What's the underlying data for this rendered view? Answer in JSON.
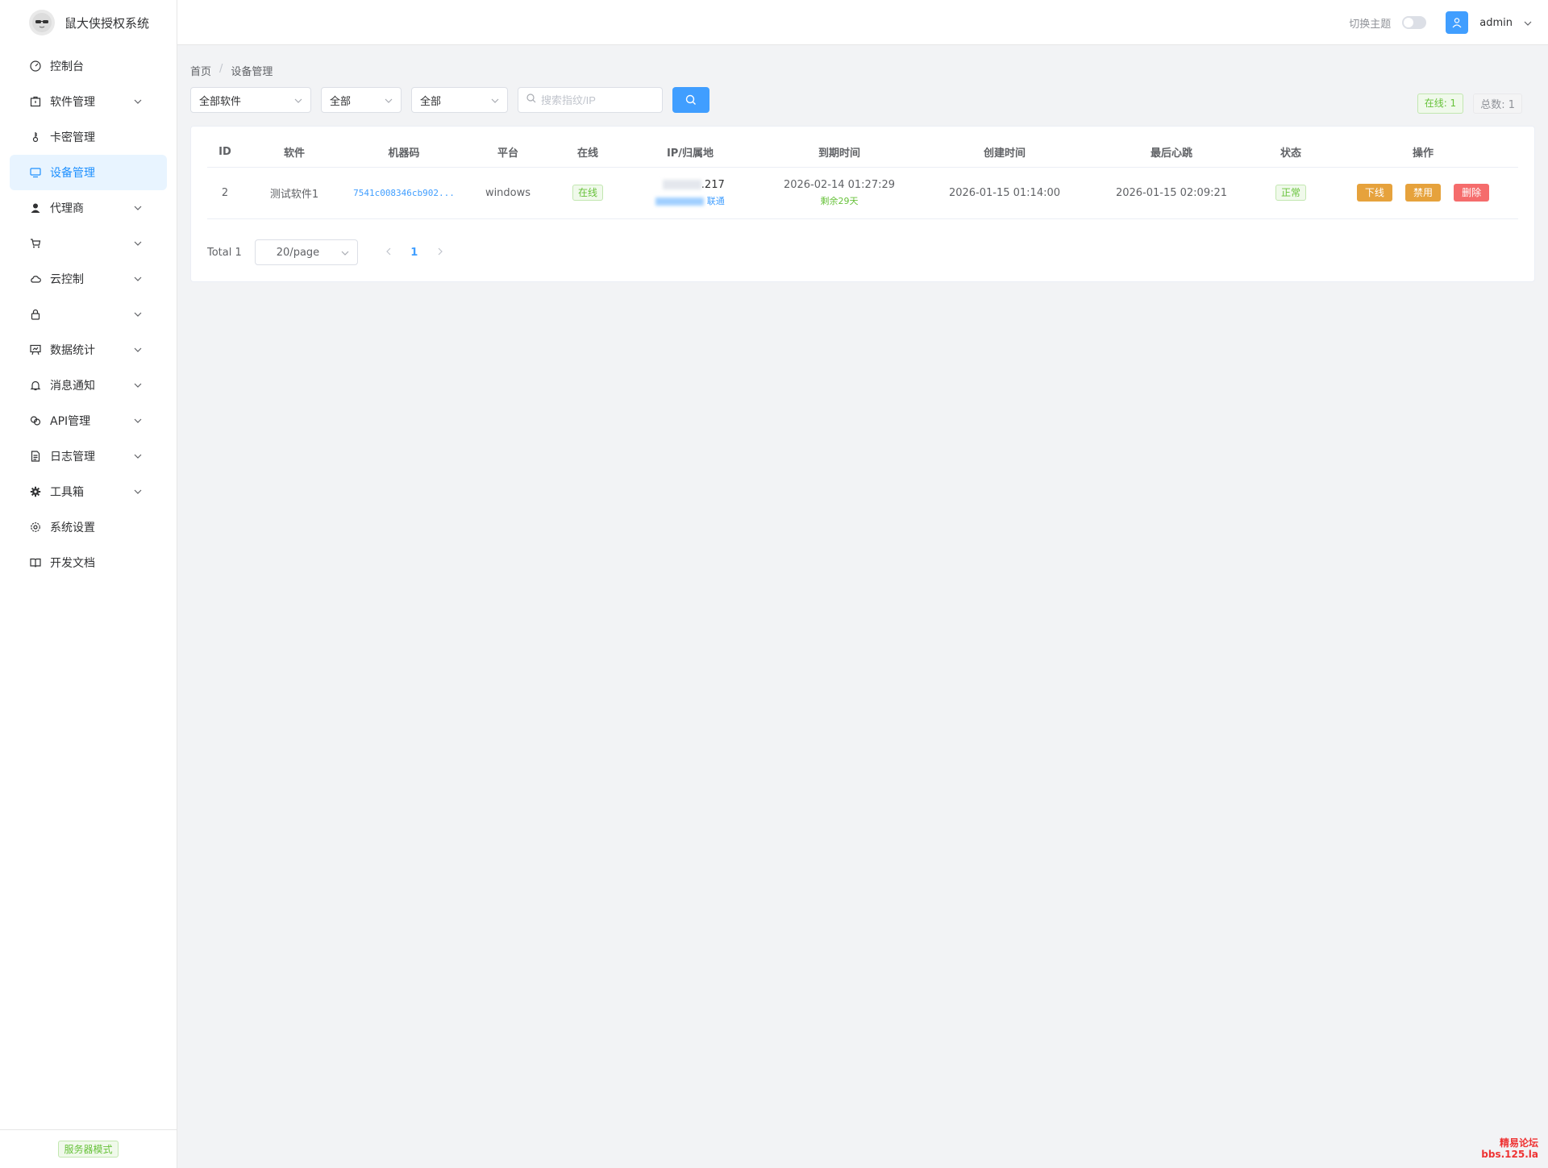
{
  "brand": {
    "title": "鼠大侠授权系统",
    "logo_icon": "cat-sunglasses-icon"
  },
  "sidebar": {
    "items": [
      {
        "label": "控制台",
        "icon": "dashboard-icon",
        "has_children": false,
        "active": false
      },
      {
        "label": "软件管理",
        "icon": "package-icon",
        "has_children": true,
        "active": false
      },
      {
        "label": "卡密管理",
        "icon": "key-icon",
        "has_children": false,
        "active": false
      },
      {
        "label": "设备管理",
        "icon": "monitor-icon",
        "has_children": false,
        "active": true
      },
      {
        "label": "代理商",
        "icon": "user-icon",
        "has_children": true,
        "active": false
      },
      {
        "label": "",
        "icon": "cart-icon",
        "has_children": true,
        "active": false,
        "redacted": true
      },
      {
        "label": "云控制",
        "icon": "cloud-icon",
        "has_children": true,
        "active": false
      },
      {
        "label": "",
        "icon": "lock-icon",
        "has_children": true,
        "active": false,
        "redacted": true
      },
      {
        "label": "数据统计",
        "icon": "chart-board-icon",
        "has_children": true,
        "active": false
      },
      {
        "label": "消息通知",
        "icon": "bell-icon",
        "has_children": true,
        "active": false
      },
      {
        "label": "API管理",
        "icon": "link-icon",
        "has_children": true,
        "active": false
      },
      {
        "label": "日志管理",
        "icon": "document-icon",
        "has_children": true,
        "active": false
      },
      {
        "label": "工具箱",
        "icon": "tools-gear-icon",
        "has_children": true,
        "active": false
      },
      {
        "label": "系统设置",
        "icon": "settings-icon",
        "has_children": false,
        "active": false
      },
      {
        "label": "开发文档",
        "icon": "book-icon",
        "has_children": false,
        "active": false
      }
    ],
    "footer_tag": "服务器模式"
  },
  "header": {
    "theme_label": "切换主题",
    "theme_dark": false,
    "user_name": "admin"
  },
  "breadcrumb": {
    "home": "首页",
    "sep": "/",
    "current": "设备管理"
  },
  "filters": {
    "software": "全部软件",
    "platform": "全部",
    "status": "全部",
    "search_placeholder": "搜索指纹/IP"
  },
  "stats": {
    "online": "在线: 1",
    "total": "总数: 1"
  },
  "table": {
    "columns": [
      "ID",
      "软件",
      "机器码",
      "平台",
      "在线",
      "IP/归属地",
      "到期时间",
      "创建时间",
      "最后心跳",
      "状态",
      "操作"
    ],
    "rows": [
      {
        "id": "2",
        "software": "测试软件1",
        "machine_code": "7541c008346cb902...",
        "platform": "windows",
        "online": "在线",
        "ip_suffix": ".217",
        "isp_suffix": "联通",
        "expire": "2026-02-14 01:27:29",
        "remaining": "剩余29天",
        "created": "2026-01-15 01:14:00",
        "heartbeat": "2026-01-15 02:09:21",
        "status": "正常",
        "actions": {
          "offline": "下线",
          "ban": "禁用",
          "delete": "删除"
        }
      }
    ]
  },
  "pagination": {
    "total": "Total 1",
    "page_size": "20/page",
    "current_page": "1"
  },
  "watermark": {
    "line1": "精易论坛",
    "line2": "bbs.125.la"
  },
  "colors": {
    "primary": "#409eff",
    "success": "#67c23a",
    "warning": "#e6a23c",
    "danger": "#f56c6c"
  }
}
